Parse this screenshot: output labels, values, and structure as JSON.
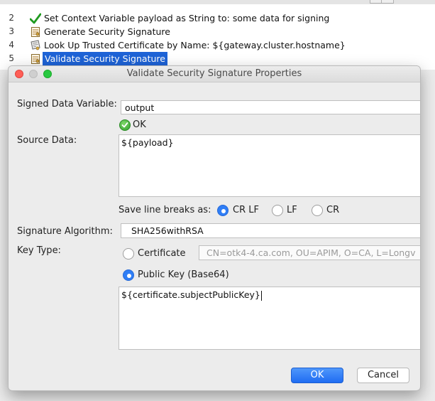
{
  "policy": {
    "lines": [
      {
        "num": "2",
        "icon": "checkmark-icon",
        "text": "Set Context Variable payload as String to: some data for signing"
      },
      {
        "num": "3",
        "icon": "document-key-icon",
        "text": "Generate Security Signature"
      },
      {
        "num": "4",
        "icon": "certificate-icon",
        "text": "Look Up Trusted Certificate by Name: ${gateway.cluster.hostname}"
      },
      {
        "num": "5",
        "icon": "document-key-icon",
        "text": "Validate Security Signature"
      }
    ]
  },
  "dialog": {
    "title": "Validate Security Signature Properties",
    "signed_data_label": "Signed Data Variable:",
    "signed_data_value": "output",
    "ok_status": "OK",
    "source_data_label": "Source Data:",
    "source_data_value": "${payload}",
    "line_breaks_label": "Save line breaks as:",
    "line_breaks": {
      "options": [
        "CR LF",
        "LF",
        "CR"
      ],
      "selected": "CR LF"
    },
    "algorithm_label": "Signature Algorithm:",
    "algorithm_value": "SHA256withRSA",
    "key_type_label": "Key Type:",
    "key_type": {
      "certificate_label": "Certificate",
      "certificate_value": "CN=otk4-4.ca.com, OU=APIM, O=CA, L=Longv",
      "public_key_label": "Public Key (Base64)",
      "selected": "Public Key (Base64)"
    },
    "public_key_value": "${certificate.subjectPublicKey}",
    "ok_button": "OK",
    "cancel_button": "Cancel"
  },
  "colors": {
    "selection": "#1e63d6",
    "primary_button": "#1f6cf2",
    "ok_green": "#2f9e2a"
  }
}
